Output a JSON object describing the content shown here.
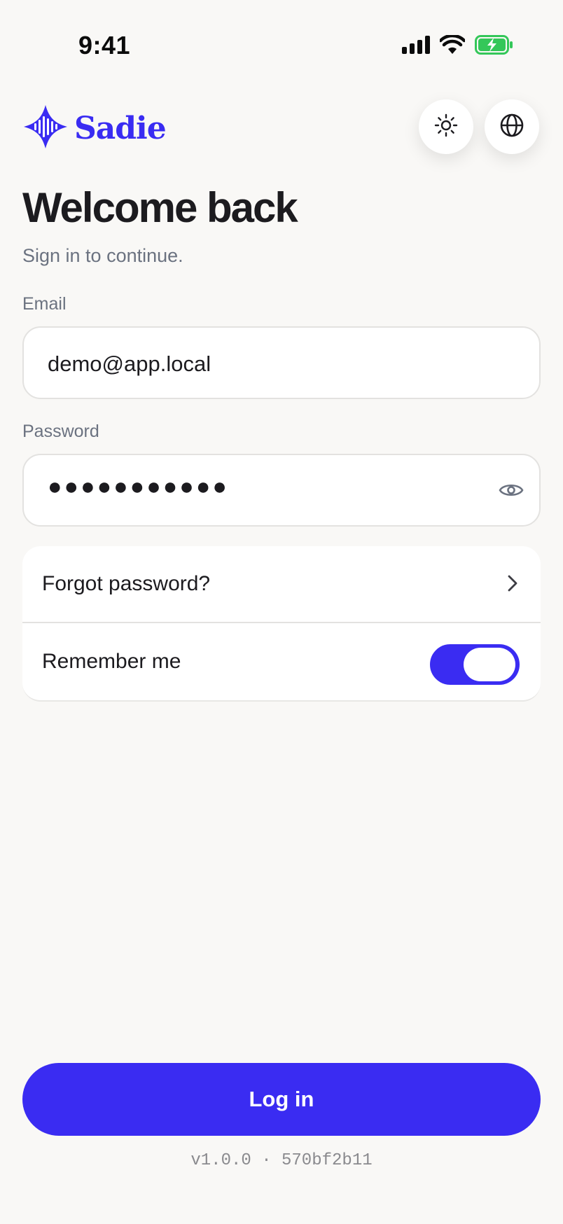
{
  "status_bar": {
    "time": "9:41",
    "signal_icon": "cellular-signal-icon",
    "wifi_icon": "wifi-icon",
    "battery_icon": "battery-charging-icon",
    "battery_color": "#34c759"
  },
  "header": {
    "brand_name": "Sadie",
    "logo_icon": "sound-wave-diamond-icon",
    "theme_icon": "sun-icon",
    "language_icon": "globe-icon"
  },
  "page": {
    "title": "Welcome back",
    "subtitle": "Sign in to continue."
  },
  "form": {
    "email_label": "Email",
    "email_value": "demo@app.local",
    "password_label": "Password",
    "password_masked": "●●●●●●●●●●●",
    "password_toggle_icon": "eye-icon"
  },
  "options": {
    "forgot_label": "Forgot password?",
    "forgot_icon": "chevron-right-icon",
    "remember_label": "Remember me",
    "remember_enabled": true
  },
  "actions": {
    "login_label": "Log in"
  },
  "footer": {
    "version": "v1.0.0 · 570bf2b11"
  },
  "colors": {
    "accent": "#3a2cf2",
    "background": "#f9f8f6",
    "muted_text": "#6b7280"
  }
}
